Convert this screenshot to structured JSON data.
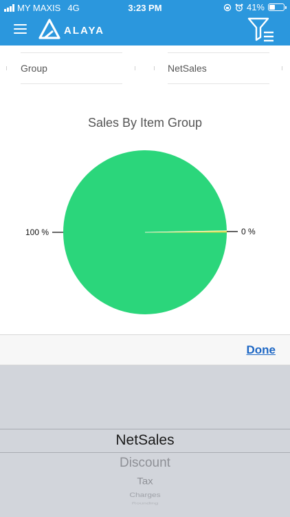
{
  "status_bar": {
    "carrier": "MY MAXIS",
    "network": "4G",
    "time": "3:23 PM",
    "battery": "41%",
    "battery_level": 0.41
  },
  "app_bar": {
    "logo_text": "ALAYA",
    "menu_icon": "hamburger-menu-icon",
    "filter_icon": "filter-list-icon",
    "color": "#2b97dd"
  },
  "filters": {
    "group_label": "Group",
    "value_label": "NetSales"
  },
  "chart_data": {
    "type": "pie",
    "title": "Sales By Item Group",
    "slices": [
      {
        "label": "100 %",
        "value": 100,
        "color": "#2bd67b"
      },
      {
        "label": "0 %",
        "value": 0.3,
        "color": "#e6dc4a"
      }
    ]
  },
  "picker": {
    "done_label": "Done",
    "options": [
      "NetSales",
      "Discount",
      "Tax",
      "Charges",
      "Rounding"
    ]
  }
}
